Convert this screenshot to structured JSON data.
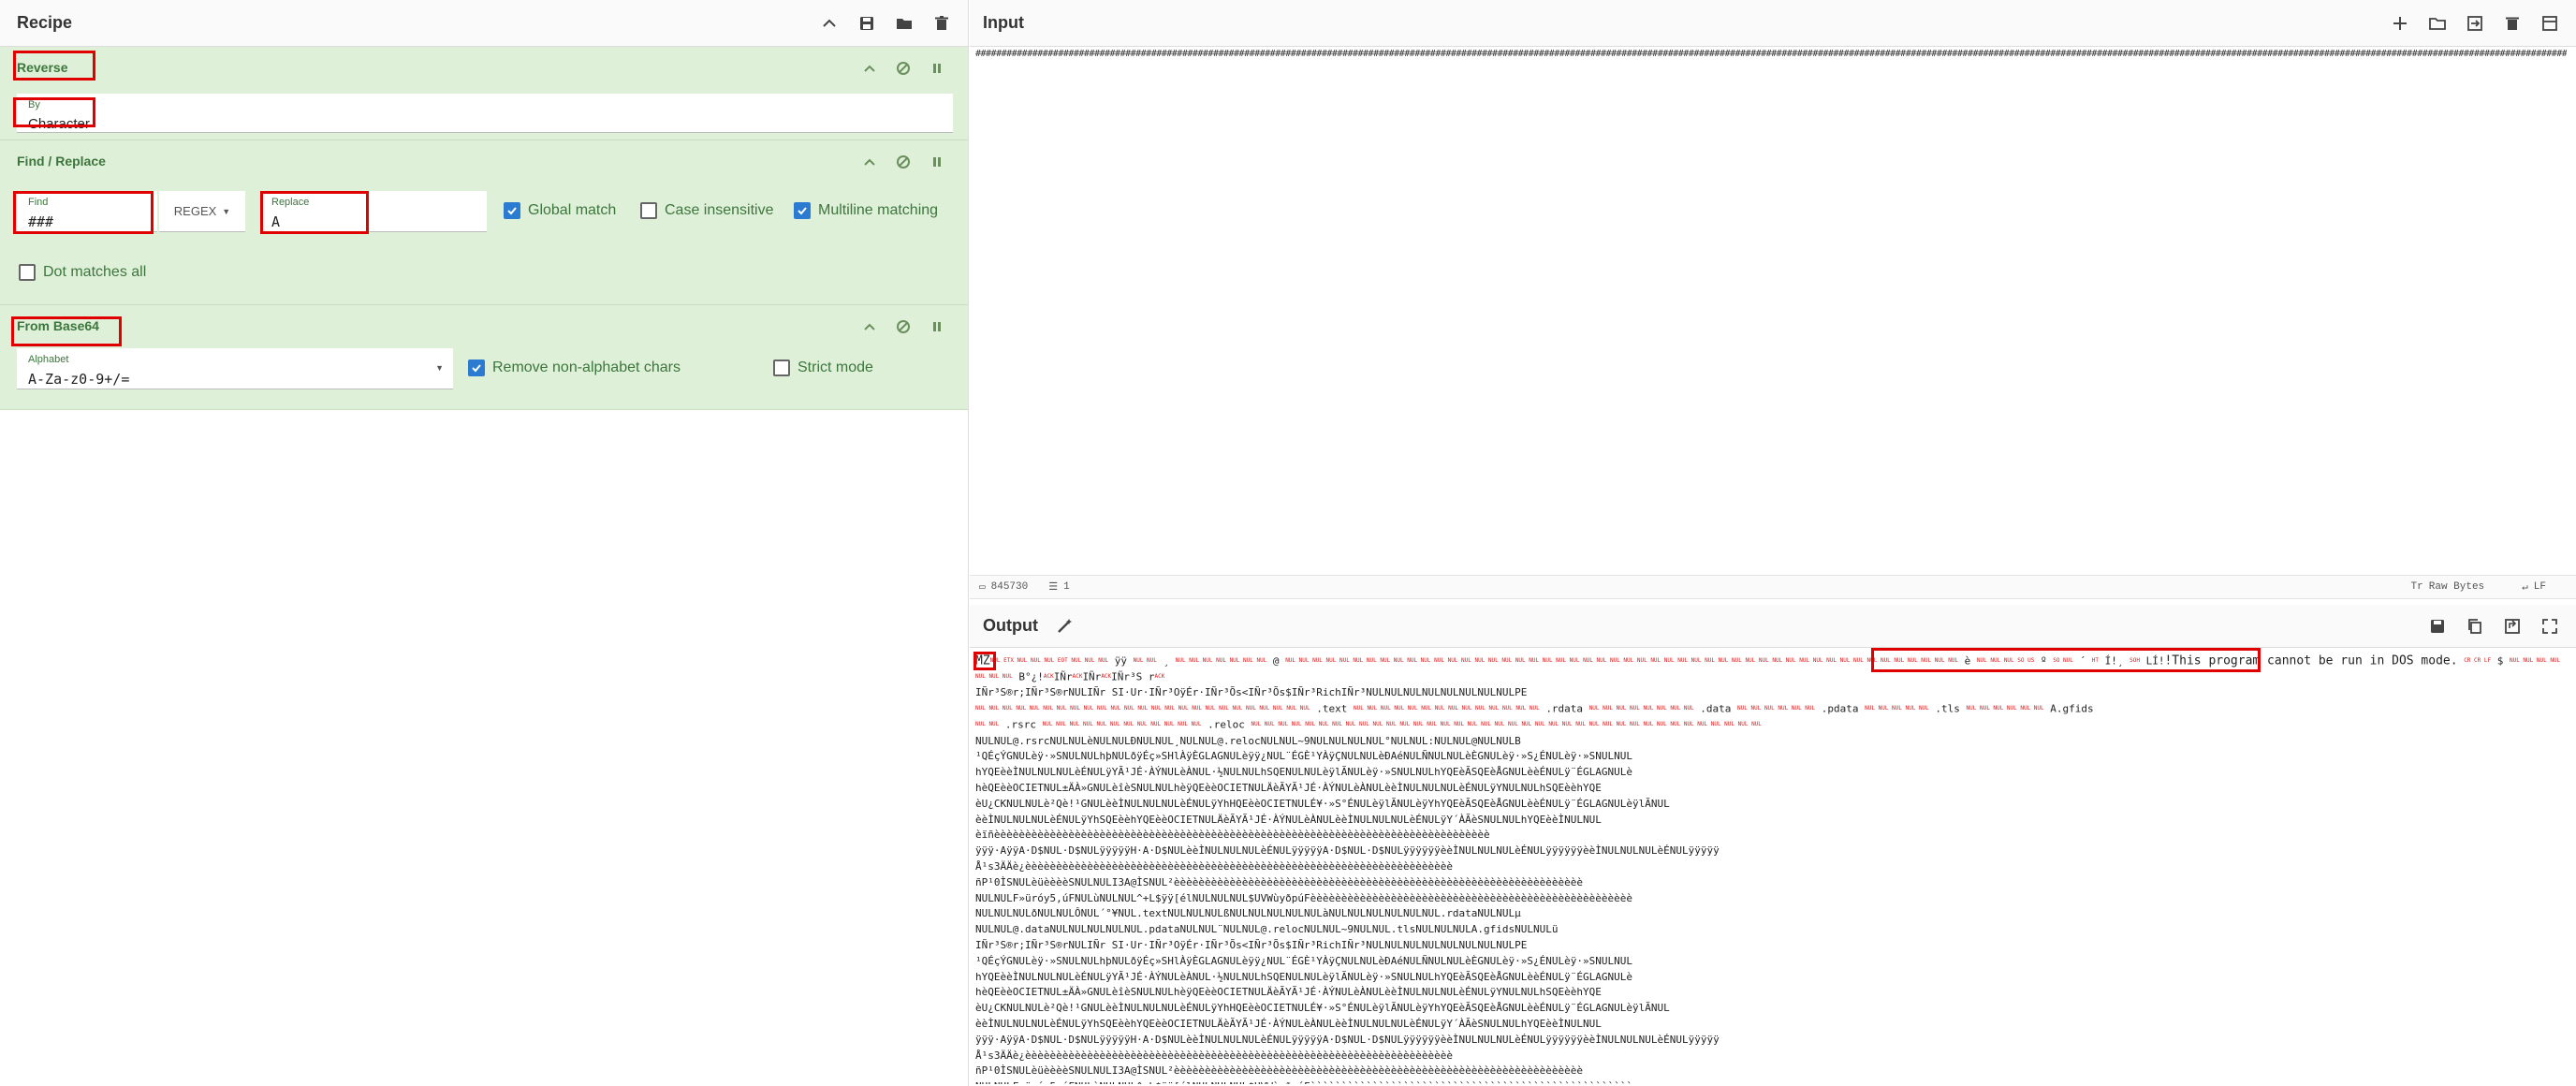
{
  "recipe": {
    "title": "Recipe",
    "header_icons": [
      "chevron-up-icon",
      "save-icon",
      "folder-icon",
      "trash-icon"
    ],
    "operations": [
      {
        "name": "Reverse",
        "by_label": "By",
        "by_value": "Character"
      },
      {
        "name": "Find / Replace",
        "find_label": "Find",
        "find_value": "###",
        "find_mode": "REGEX",
        "replace_label": "Replace",
        "replace_value": "A",
        "global_match": "Global match",
        "global_match_checked": true,
        "case_insensitive": "Case insensitive",
        "case_insensitive_checked": false,
        "multiline_matching": "Multiline matching",
        "multiline_matching_checked": true,
        "dot_matches_all": "Dot matches all",
        "dot_matches_all_checked": false
      },
      {
        "name": "From Base64",
        "alphabet_label": "Alphabet",
        "alphabet_value": "A-Za-z0-9+/=",
        "remove_non_alphabet": "Remove non-alphabet chars",
        "remove_non_alphabet_checked": true,
        "strict_mode": "Strict mode",
        "strict_mode_checked": false
      }
    ]
  },
  "input": {
    "title": "Input",
    "header_icons": [
      "plus-icon",
      "folder-open-icon",
      "import-icon",
      "trash-icon",
      "layout-icon"
    ],
    "content": "################################################################################################################################################################################################################################################################################################################################################################################################################################################################################################################################################################################",
    "status_chars": "845730",
    "status_lines": "1",
    "raw_bytes": "Raw Bytes",
    "line_ending": "LF"
  },
  "output": {
    "title": "Output",
    "header_icons": [
      "save-icon",
      "copy-icon",
      "replace-input-icon",
      "fullscreen-icon"
    ],
    "first_chars": "MZ",
    "dos_message": "!This program cannot be run in DOS mode.",
    "sections": [
      ".text",
      ".rdata",
      ".data",
      ".pdata",
      ".rsrc",
      ".reloc",
      ".tls",
      "A.gfids"
    ],
    "lines": [
      "MZNUL\u0003NULNULNUL\u0004NULNULNULÿÿNULNUL¸NULNULNULNULNULNULNUL@NULNULNULNULNULNULNULNULNULNULNULNULNULNULNULNULNULNULNULNULNULNULNULNULNULNULNULNULNULNULNULNULNULNULNULNULèNULNULNUL\u000e\u001fº\u000eNUL´\tÍ!¸\u0001LÍ!",
      "IÑr³S®r;IÑr³S®rNULIÑr SI·Ur·IÑr³OÿÉr·IÑr³Õs<IÑr³Õs$IÑr³RichIÑr³NULNULNULNULNULNULNULNULPE",
      "NULNUL\u0006NULð­\u0014NULNULÔNUL´°¥NUL.textNULNULNULßNULNUL\u0010NULNULNULàNULNUL\u0004NULNULNULNUL.rdataNULNULµ",
      "NULNUL@.dataNULNULNUL\u001b\u0011NULNUL.pdataNULNUL¨\u0015NULNUL@.relocNULNUL~9NULNUL.tlsNULNULNULA.gfidsNULNULü",
      "NULNUL@.rsrcNULNULè\u0007NULNULÐNULNUL¸NULNUL@.relocNULNUL~9NULNUL\u0010NULNUL°NULNUL:NULNUL@NULNULB",
      "¹QÉçÝGNULèÿ·»SNULNULhþNULðÿÉç»SHlÀÿÈGLAGNULèÿÿ¿NUL¨ÉGÈ¹YÀÿÇNULNULèÐAéNULÑNULNULèÈGNULèÿ·»S¿ÉNULèÿ·»SNULNUL",
      "hYQEèèÌNULNULNULèÉNULÿYÃ¹JÉ·ÀÝNULèÀNUL·½NULNULhSQENULNULèÿlÃNULèÿ·»SNULNULhYQEèÃSQEèÅGNULèèÉNULÿ¨ÉGLAGNULè",
      "hèQEèèOCIETNUL±ÄÀ»GNULèîèSNULNULhèÿQEèèOCIETNULÄèÃYÃ¹JÉ·ÀÝNULèÀNULèèÌNULNULNULèÉNULÿYNULNULhSQEèèhYQE",
      "èU¿CKNULNULè²Qè!¹GNULèèÌNULNULNULèÉNULÿYhHQEèèOCIETNULÉ¥·»S°ÉNULèÿlÃNULèÿYhYQEèÃSQEèÅGNULèèÉNULÿ¨ÉGLAGNULèÿlÃNUL",
      "èèÌNULNULNULèÉNULÿYhSQEèèhYQEèèOCIETNULÄèÃYÃ¹JÉ·ÀÝNULèÀNULèèÌNULNULNULèÉNULÿY´ÀÃèSNULNULhYQEèèÌNULNUL",
      "èïñèèèèèèèèèèèèèèèèèèèèèèèèèèèèèèèèèèèèèèèèèèèèèèèèèèèèèèèèèèèèèèèèèèèèèèèèèèèèèèèè",
      "ÿÿÿ·AÿÿA·D$NUL·D$NULÿÿÿÿÿH·A·D$NULèèÌNULNULNULèÉNULÿÿÿÿÿA·D$NUL·D$NULÿÿÿÿÿÿèèÌNULNULNULèÉNULÿÿÿÿÿÿèèÌNULNULNULèÉNULÿÿÿÿÿ",
      "Å¹s3ÄÄè¿èèèèèèèèèèèèèèèèèèèèèèèèèèèèèèèèèèèèèèèèèèèèèèèèèèèèèèèèèèèèèèèèèèèèè",
      "ñP¹0ÌSNULèüèèèèSNULNULI3A@ÌSNUL²èèèèèèèèèèèèèèèèèèèèèèèèèèèèèèèèèèèèèèèèèèèèèèèèèèèèèèèèèèèèèèèèèè",
      "NULNULF»üróy5,úFNULùNULNUL^+L$ÿÿ[élNULNULNUL$UVWùyðpúFèèèèèèèèèèèèèèèèèèèèèèèèèèèèèèèèèèèèèèèèèèèèèèèèèèèè"
    ]
  }
}
